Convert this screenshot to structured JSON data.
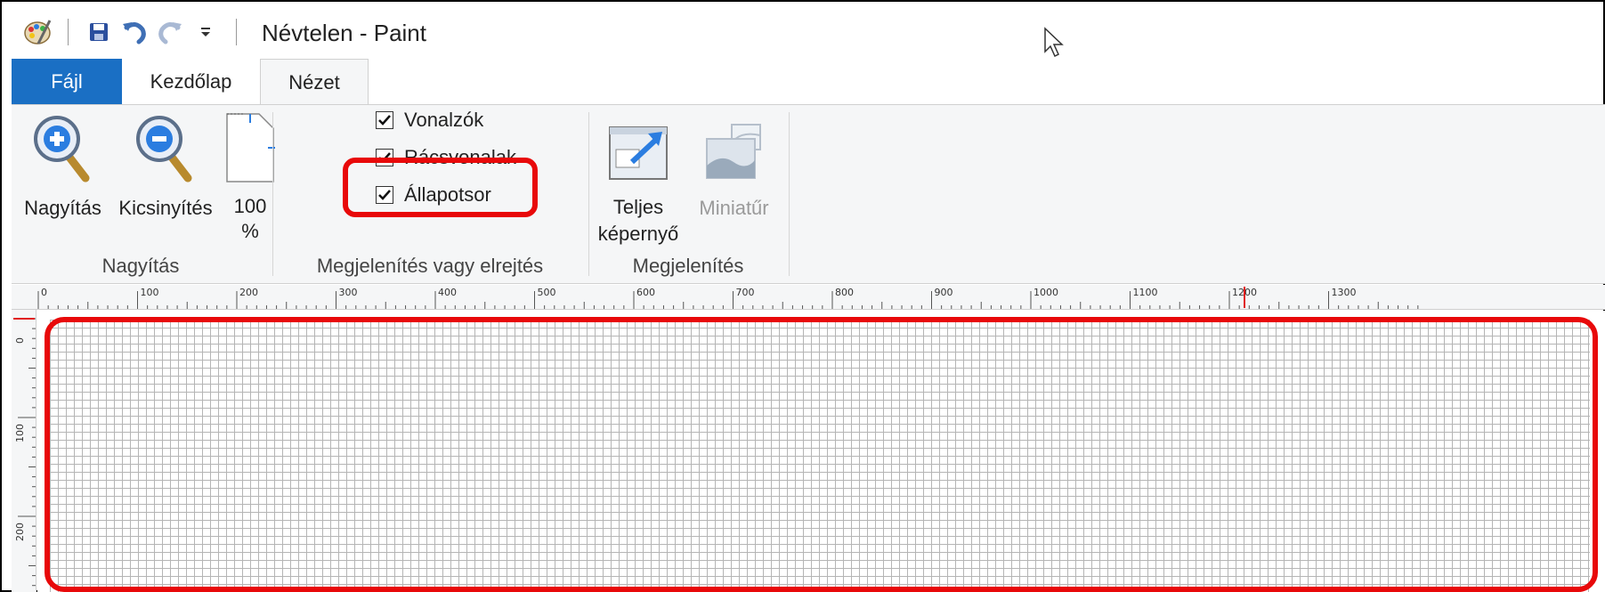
{
  "window": {
    "title": "Névtelen - Paint"
  },
  "tabs": [
    {
      "label": "Fájl"
    },
    {
      "label": "Kezdőlap"
    },
    {
      "label": "Nézet"
    }
  ],
  "ribbon": {
    "zoom_group": {
      "label": "Nagyítás",
      "zoom_in": "Nagyítás",
      "zoom_out": "Kicsinyítés",
      "hundred_line1": "100",
      "hundred_line2": "%"
    },
    "show_group": {
      "label": "Megjelenítés vagy elrejtés",
      "rulers": {
        "label": "Vonalzók",
        "checked": true
      },
      "gridlines": {
        "label": "Rácsvonalak",
        "checked": true
      },
      "statusbar": {
        "label": "Állapotsor",
        "checked": true
      }
    },
    "display_group": {
      "label": "Megjelenítés",
      "fullscreen_line1": "Teljes",
      "fullscreen_line2": "képernyő",
      "thumbnail": "Miniatűr"
    }
  },
  "ruler": {
    "horizontal": [
      "0",
      "100",
      "200",
      "300",
      "400",
      "500",
      "600",
      "700",
      "800",
      "900",
      "1000",
      "1100",
      "1200",
      "1300"
    ],
    "vertical": [
      "0",
      "100",
      "200"
    ]
  },
  "colors": {
    "accent": "#1a6fc4",
    "highlight": "#e8090a"
  }
}
